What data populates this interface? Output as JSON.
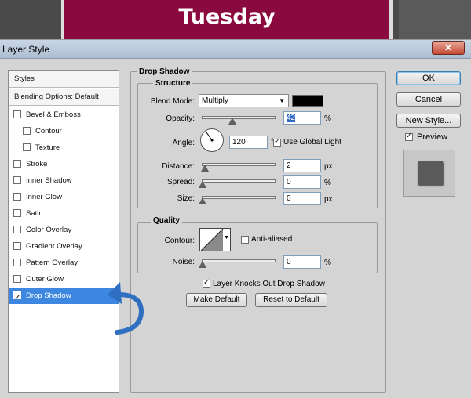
{
  "canvas": {
    "banner_text": "Tuesday",
    "banner_color": "#8a0a40"
  },
  "dialog": {
    "title": "Layer Style",
    "close_label": "✕"
  },
  "styles_list": [
    {
      "label": "Styles",
      "kind": "header"
    },
    {
      "label": "Blending Options: Default",
      "kind": "header"
    },
    {
      "label": "Bevel & Emboss",
      "checked": false
    },
    {
      "label": "Contour",
      "checked": false,
      "sub": true
    },
    {
      "label": "Texture",
      "checked": false,
      "sub": true
    },
    {
      "label": "Stroke",
      "checked": false
    },
    {
      "label": "Inner Shadow",
      "checked": false
    },
    {
      "label": "Inner Glow",
      "checked": false
    },
    {
      "label": "Satin",
      "checked": false
    },
    {
      "label": "Color Overlay",
      "checked": false
    },
    {
      "label": "Gradient Overlay",
      "checked": false
    },
    {
      "label": "Pattern Overlay",
      "checked": false
    },
    {
      "label": "Outer Glow",
      "checked": false
    },
    {
      "label": "Drop Shadow",
      "checked": true,
      "selected": true
    }
  ],
  "drop_shadow": {
    "title": "Drop Shadow",
    "structure": {
      "title": "Structure",
      "blend_mode_label": "Blend Mode:",
      "blend_mode_value": "Multiply",
      "shadow_color": "#000000",
      "opacity_label": "Opacity:",
      "opacity_value": "42",
      "opacity_unit": "%",
      "opacity_fraction": 0.42,
      "angle_label": "Angle:",
      "angle_value": "120",
      "angle_unit": "°",
      "use_global_light_label": "Use Global Light",
      "use_global_light": true,
      "distance_label": "Distance:",
      "distance_value": "2",
      "distance_unit": "px",
      "spread_label": "Spread:",
      "spread_value": "0",
      "spread_unit": "%",
      "size_label": "Size:",
      "size_value": "0",
      "size_unit": "px"
    },
    "quality": {
      "title": "Quality",
      "contour_label": "Contour:",
      "anti_aliased_label": "Anti-aliased",
      "anti_aliased": false,
      "noise_label": "Noise:",
      "noise_value": "0",
      "noise_unit": "%"
    },
    "knockout_label": "Layer Knocks Out Drop Shadow",
    "knockout": true,
    "make_default": "Make Default",
    "reset_default": "Reset to Default"
  },
  "buttons": {
    "ok": "OK",
    "cancel": "Cancel",
    "new_style": "New Style...",
    "preview": "Preview",
    "preview_checked": true
  }
}
